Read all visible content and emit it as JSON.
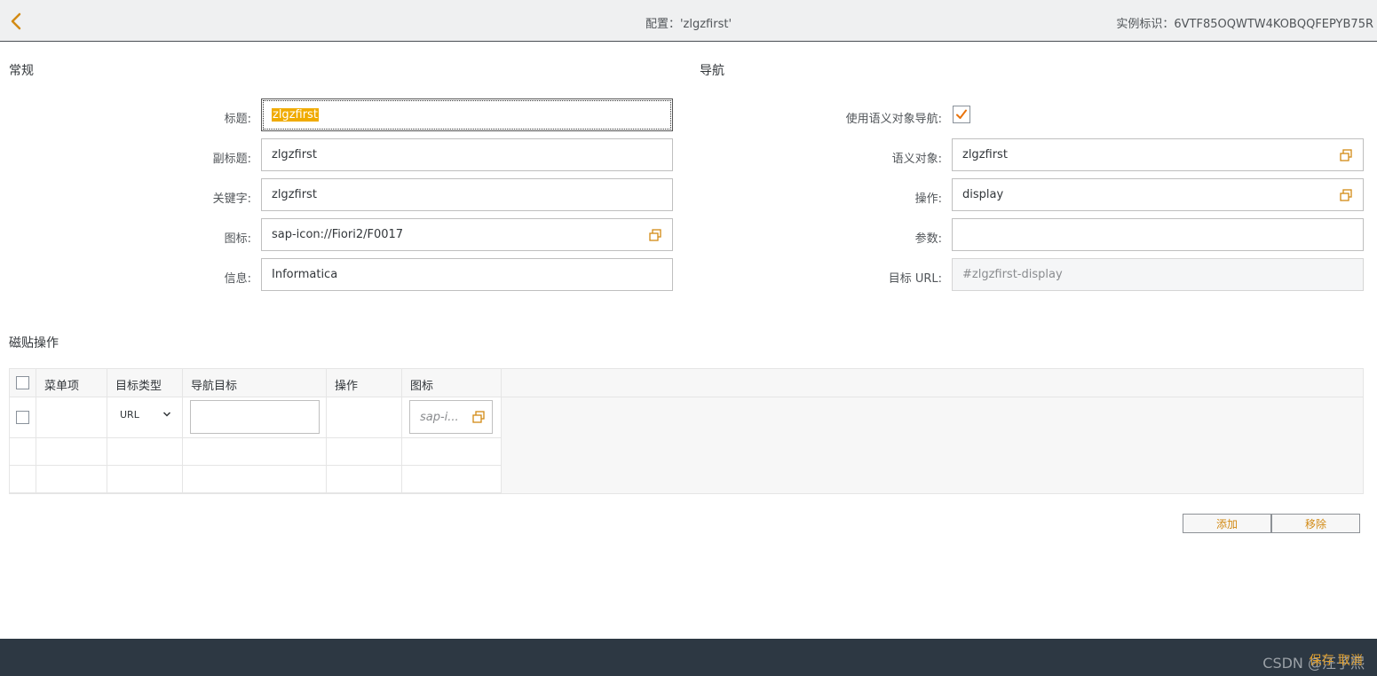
{
  "header": {
    "title": "配置：'zlgzfirst'",
    "instance_id": "实例标识：6VTF85OQWTW4KOBQQFEPYB75R"
  },
  "general": {
    "section_title": "常规",
    "title_label": "标题:",
    "title_value": "zlgzfirst",
    "subtitle_label": "副标题:",
    "subtitle_value": "zlgzfirst",
    "keywords_label": "关键字:",
    "keywords_value": "zlgzfirst",
    "icon_label": "图标:",
    "icon_value": "sap-icon://Fiori2/F0017",
    "info_label": "信息:",
    "info_value": "Informatica"
  },
  "navigation": {
    "section_title": "导航",
    "use_semantic_label": "使用语义对象导航:",
    "use_semantic_checked": true,
    "semantic_object_label": "语义对象:",
    "semantic_object_value": "zlgzfirst",
    "action_label": "操作:",
    "action_value": "display",
    "params_label": "参数:",
    "params_value": "",
    "target_url_label": "目标 URL:",
    "target_url_value": "#zlgzfirst-display"
  },
  "tile_actions": {
    "section_title": "磁贴操作",
    "columns": [
      "菜单项",
      "目标类型",
      "导航目标",
      "操作",
      "图标"
    ],
    "row": {
      "target_type": "URL",
      "icon_placeholder": "sap-i..."
    },
    "add_button": "添加",
    "remove_button": "移除"
  },
  "footer": {
    "watermark": "CSDN @汪子熙",
    "accent": "保存 取消"
  },
  "colors": {
    "accent": "#d28a14",
    "check": "#e9730c",
    "footer": "#2d3843"
  }
}
